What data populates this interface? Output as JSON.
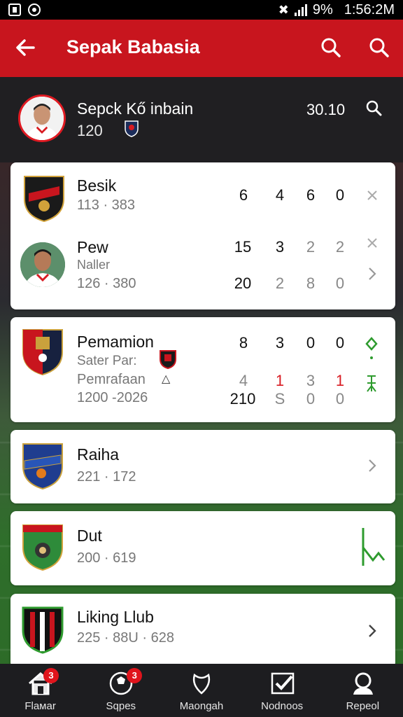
{
  "status_bar": {
    "battery": "9%",
    "time": "1:56:2M"
  },
  "app_bar": {
    "title": "Sepak Babasia"
  },
  "profile": {
    "name": "Sepck Kő inbain",
    "number": "120",
    "score": "30.10"
  },
  "cards": [
    {
      "rows": [
        {
          "name": "Besik",
          "sub": "113 · 383",
          "values": [
            "6",
            "4",
            "6",
            "0"
          ],
          "logo": "dark-red-shield-icon",
          "trailing": "x-icon"
        },
        {
          "name": "Pew",
          "sub": "Naller",
          "sub2": "126 · 380",
          "values": [
            "15",
            "3",
            "2",
            "2"
          ],
          "values2": [
            "20",
            "2",
            "8",
            "0"
          ],
          "logo": "player-avatar",
          "trailing": "x-icon"
        }
      ]
    },
    {
      "rows": [
        {
          "name": "Pemamion",
          "sub": "Sater Par:",
          "sub2": "Pemrafaan",
          "sub3": "1200 -2026",
          "values": [
            "8",
            "3",
            "0",
            "0"
          ],
          "values2": [
            "4",
            "1",
            "3",
            "1"
          ],
          "values3": [
            "210",
            "S",
            "0",
            "0"
          ],
          "logo": "navy-red-crest-icon",
          "trailing": "green-diamond-icon"
        }
      ]
    },
    {
      "rows": [
        {
          "name": "Raiha",
          "sub": "221 · 172",
          "logo": "blue-shield-icon",
          "trailing": "chevron-right-icon"
        }
      ]
    },
    {
      "rows": [
        {
          "name": "Dut",
          "sub": "200 · 619",
          "logo": "green-red-shield-icon",
          "trailing": "green-chart-icon"
        }
      ]
    },
    {
      "rows": [
        {
          "name": "Liking Llub",
          "sub": "225 · 88U · 628",
          "logo": "black-red-stripe-shield-icon",
          "trailing": "chevron-right-icon"
        }
      ]
    }
  ],
  "bottom_nav": [
    {
      "label": "Flaмar",
      "badge": "3",
      "icon": "home-icon"
    },
    {
      "label": "Sqpes",
      "badge": "3",
      "icon": "ball-icon"
    },
    {
      "label": "Maongah",
      "badge": "",
      "icon": "shield-heart-icon"
    },
    {
      "label": "Nodnoos",
      "badge": "",
      "icon": "check-icon"
    },
    {
      "label": "Repeol",
      "badge": "",
      "icon": "profile-icon"
    }
  ],
  "colors": {
    "brand_red": "#c8151e",
    "accent_green": "#2e9b2e"
  }
}
